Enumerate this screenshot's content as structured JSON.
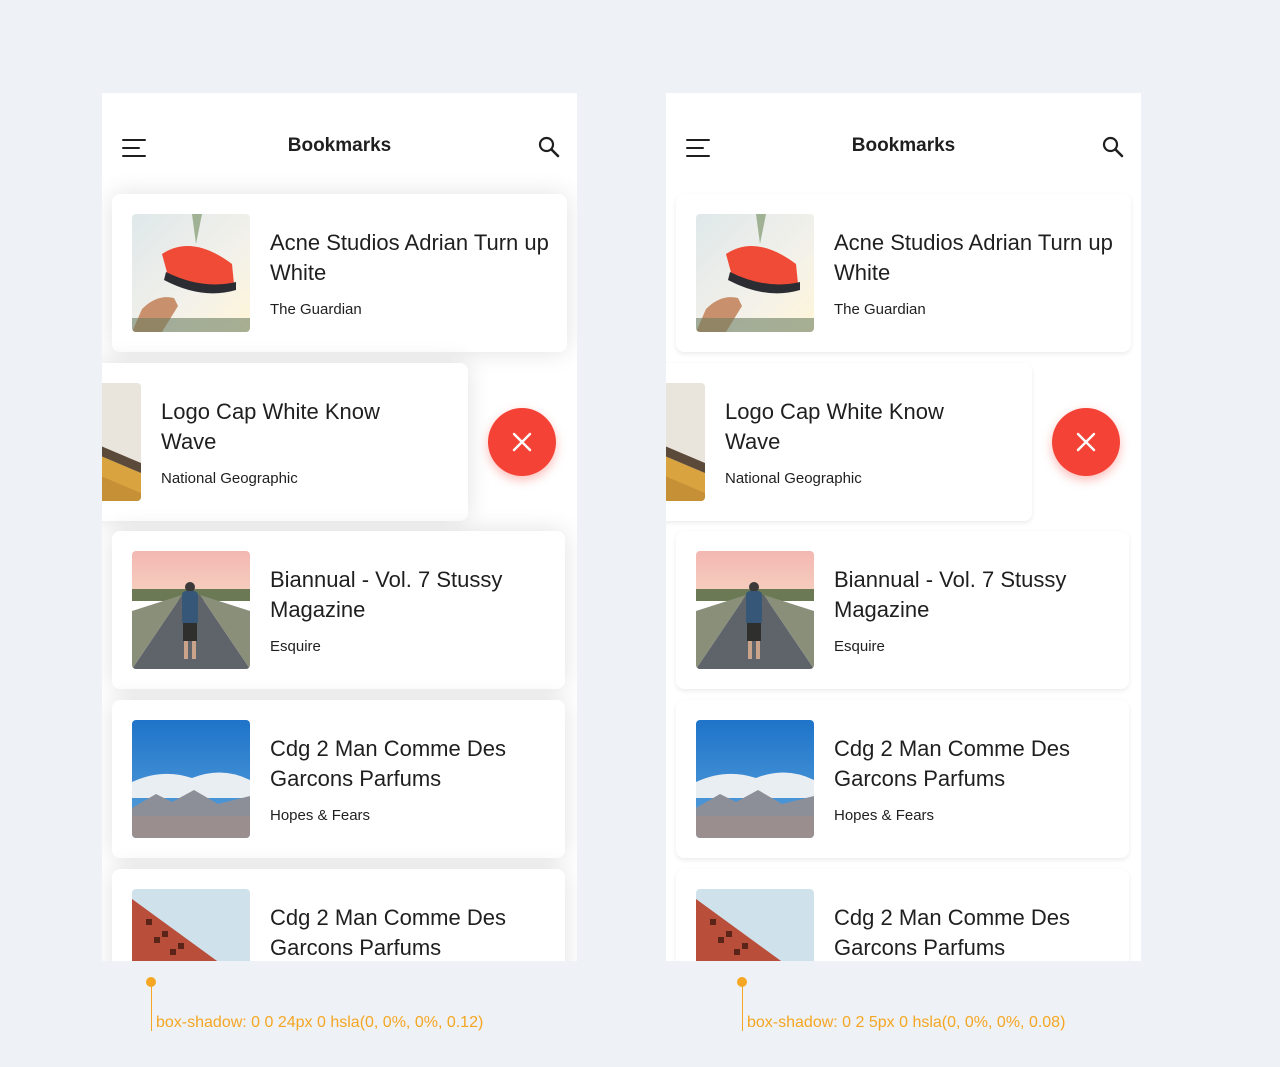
{
  "colors": {
    "background": "#eef1f5",
    "card": "#ffffff",
    "accent_delete": "#f44336",
    "annotation": "#f5a623"
  },
  "screens": [
    {
      "header": {
        "title": "Bookmarks",
        "menu_icon": "menu-icon",
        "search_icon": "search-icon"
      },
      "cards": [
        {
          "title": "Acne Studios Adrian Turn up White",
          "source": "The Guardian",
          "image": "sneaker-photo"
        },
        {
          "title": "Logo Cap White Know Wave",
          "source": "National Geographic",
          "image": "building-photo"
        },
        {
          "title": "Biannual - Vol. 7 Stussy Magazine",
          "source": "Esquire",
          "image": "road-walker-photo"
        },
        {
          "title": "Cdg 2 Man Comme Des Garcons Parfums",
          "source": "Hopes & Fears",
          "image": "mountain-sky-photo"
        },
        {
          "title": "Cdg 2 Man Comme Des Garcons Parfums",
          "source": "",
          "image": "red-building-photo"
        }
      ],
      "delete_icon": "close-icon",
      "annotation": "box-shadow: 0 0 24px 0  hsla(0, 0%, 0%, 0.12)"
    },
    {
      "header": {
        "title": "Bookmarks",
        "menu_icon": "menu-icon",
        "search_icon": "search-icon"
      },
      "cards": [
        {
          "title": "Acne Studios Adrian Turn up White",
          "source": "The Guardian",
          "image": "sneaker-photo"
        },
        {
          "title": "Logo Cap White Know Wave",
          "source": "National Geographic",
          "image": "building-photo"
        },
        {
          "title": "Biannual - Vol. 7 Stussy Magazine",
          "source": "Esquire",
          "image": "road-walker-photo"
        },
        {
          "title": "Cdg 2 Man Comme Des Garcons Parfums",
          "source": "Hopes & Fears",
          "image": "mountain-sky-photo"
        },
        {
          "title": "Cdg 2 Man Comme Des Garcons Parfums",
          "source": "",
          "image": "red-building-photo"
        }
      ],
      "delete_icon": "close-icon",
      "annotation": "box-shadow: 0 2 5px 0  hsla(0, 0%, 0%, 0.08)"
    }
  ]
}
